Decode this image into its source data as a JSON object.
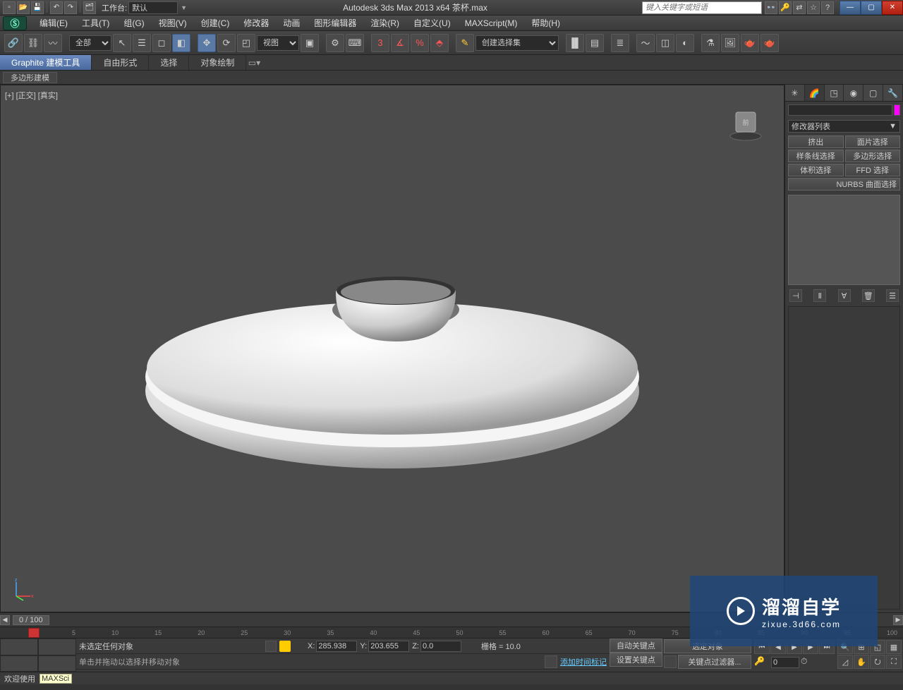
{
  "titlebar": {
    "workspace_label": "工作台:",
    "workspace_value": "默认",
    "app_title": "Autodesk 3ds Max  2013 x64    茶杯.max",
    "search_placeholder": "键入关键字或短语"
  },
  "menus": [
    "编辑(E)",
    "工具(T)",
    "组(G)",
    "视图(V)",
    "创建(C)",
    "修改器",
    "动画",
    "图形编辑器",
    "渲染(R)",
    "自定义(U)",
    "MAXScript(M)",
    "帮助(H)"
  ],
  "toolbar": {
    "filter_dd": "全部",
    "view_dd": "视图",
    "selset_dd": "创建选择集",
    "snap_num": "3"
  },
  "ribbon": {
    "tabs": [
      "Graphite 建模工具",
      "自由形式",
      "选择",
      "对象绘制"
    ],
    "sub": "多边形建模"
  },
  "viewport": {
    "label": "[+] [正交] [真实]"
  },
  "cmdpanel": {
    "modlist": "修改器列表",
    "btns": [
      "挤出",
      "面片选择",
      "样条线选择",
      "多边形选择",
      "体积选择",
      "FFD 选择"
    ],
    "nurbs": "NURBS 曲面选择"
  },
  "timeline": {
    "frame_indicator": "0 / 100",
    "ticks": [
      "0",
      "5",
      "10",
      "15",
      "20",
      "25",
      "30",
      "35",
      "40",
      "45",
      "50",
      "55",
      "60",
      "65",
      "70",
      "75",
      "80",
      "85",
      "90",
      "95",
      "100"
    ]
  },
  "status": {
    "selection": "未选定任何对象",
    "hint": "单击并拖动以选择并移动对象",
    "x_label": "X:",
    "x": "285.938",
    "y_label": "Y:",
    "y": "203.655",
    "z_label": "Z:",
    "z": "0.0",
    "grid": "栅格 = 10.0",
    "addtime": "添加时间标记",
    "autokey": "自动关键点",
    "setkey": "设置关键点",
    "sel_obj": "选定对象",
    "keyfilter": "关键点过滤器...",
    "curframe": "0"
  },
  "maxscript": {
    "welcome": "欢迎使用",
    "listener": "MAXSci"
  },
  "watermark": {
    "big": "溜溜自学",
    "small": "zixue.3d66.com"
  }
}
